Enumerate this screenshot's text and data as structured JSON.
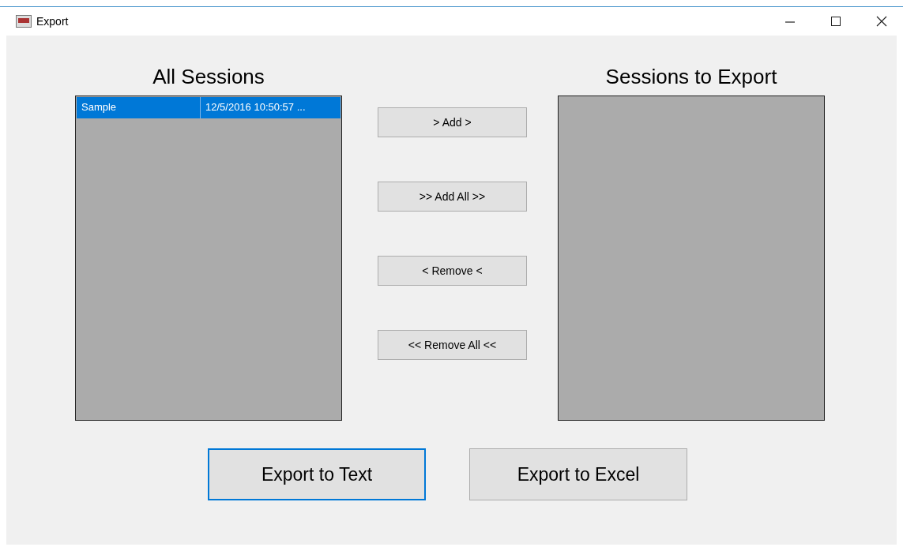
{
  "window": {
    "title": "Export"
  },
  "all_sessions": {
    "heading": "All Sessions",
    "rows": [
      {
        "cells": [
          "Sample",
          "12/5/2016 10:50:57 ..."
        ],
        "selected": true
      }
    ]
  },
  "transfer_buttons": [
    {
      "label": "> Add >"
    },
    {
      "label": ">> Add All >>"
    },
    {
      "label": "< Remove <"
    },
    {
      "label": "<< Remove All <<"
    }
  ],
  "sessions_to_export": {
    "heading": "Sessions to Export"
  },
  "export_buttons": [
    {
      "label": "Export to Text",
      "focused": true
    },
    {
      "label": "Export to Excel",
      "focused": false
    }
  ]
}
